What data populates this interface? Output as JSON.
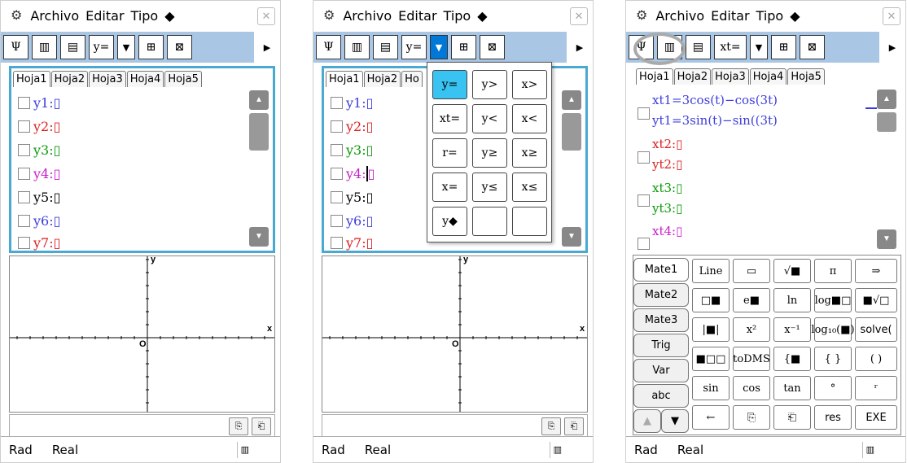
{
  "menu": {
    "gear": "⚙",
    "items": [
      "Archivo",
      "Editar",
      "Tipo",
      "◆"
    ],
    "close": "✕"
  },
  "toolbar": {
    "p12": [
      "Ψ",
      "▥",
      "▤",
      "y=",
      "▼",
      "⊞",
      "⊠"
    ],
    "p3": [
      "Ψ",
      "▥",
      "▤",
      "xt=",
      "▼",
      "⊞",
      "⊠"
    ],
    "arrow": "▶"
  },
  "tabs": [
    "Hoja1",
    "Hoja2",
    "Hoja3",
    "Hoja4",
    "Hoja5"
  ],
  "tabs_p2": [
    "Hoja1",
    "Hoja2",
    "Ho"
  ],
  "functions": [
    {
      "label": "y1:",
      "color": "#3c3cdc"
    },
    {
      "label": "y2:",
      "color": "#dc1e1e"
    },
    {
      "label": "y3:",
      "color": "#0a9a0a"
    },
    {
      "label": "y4:",
      "color": "#c81ec8"
    },
    {
      "label": "y5:",
      "color": "#000000"
    },
    {
      "label": "y6:",
      "color": "#3c3cdc"
    },
    {
      "label": "y7:",
      "color": "#dc1e1e"
    }
  ],
  "empty_glyph": "▯",
  "graph": {
    "x_axis": "x",
    "y_axis": "y",
    "origin": "O"
  },
  "history": [
    "⎘",
    "⎗"
  ],
  "status": {
    "angle": "Rad",
    "mode": "Real",
    "battery": "▥"
  },
  "popup": {
    "rows": [
      [
        "y=",
        "y>",
        "x>"
      ],
      [
        "xt=",
        "y<",
        "x<"
      ],
      [
        "r=",
        "y≥",
        "x≥"
      ],
      [
        "x=",
        "y≤",
        "x≤"
      ],
      [
        "y◆",
        "",
        ""
      ]
    ]
  },
  "panel3": {
    "expr": [
      {
        "text": "xt1=3cos(t)−cos(3t)",
        "color": "#3c3cdc"
      },
      {
        "text": "yt1=3sin(t)−sin((3t)",
        "color": "#3c3cdc"
      },
      {
        "text": "xt2:",
        "color": "#dc1e1e"
      },
      {
        "text": "yt2:",
        "color": "#dc1e1e"
      },
      {
        "text": "xt3:",
        "color": "#0a9a0a"
      },
      {
        "text": "yt3:",
        "color": "#0a9a0a"
      },
      {
        "text": "xt4:",
        "color": "#c81ec8"
      }
    ],
    "keyboard_tabs": [
      "Mate1",
      "Mate2",
      "Mate3",
      "Trig",
      "Var",
      "abc"
    ],
    "nav": [
      "▲",
      "▼"
    ],
    "keys": [
      [
        "Line",
        "▭",
        "√■",
        "π",
        "⇒"
      ],
      [
        "□■",
        "e■",
        "ln",
        "log■□",
        "■√□"
      ],
      [
        "|■|",
        "x²",
        "x⁻¹",
        "log₁₀(■)",
        "solve("
      ],
      [
        "■□□",
        "toDMS",
        "{■",
        "{ }",
        "( )"
      ],
      [
        "sin",
        "cos",
        "tan",
        "°",
        "ʳ"
      ],
      [
        "←",
        "⎘",
        "⎗",
        "res",
        "EXE"
      ]
    ]
  }
}
